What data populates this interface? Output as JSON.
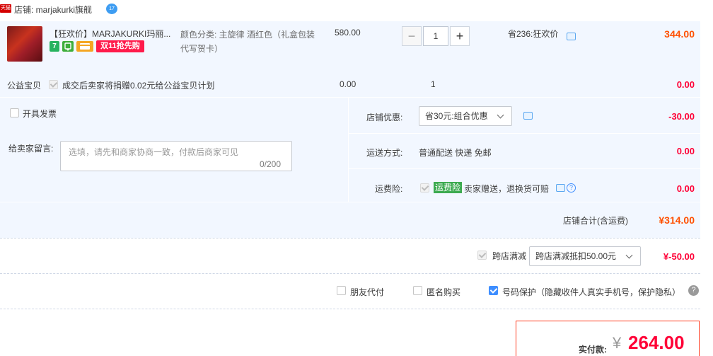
{
  "shop": {
    "badge": "天猫",
    "name": "店铺: marjakurki旗舰",
    "chat_badge": "17"
  },
  "item": {
    "title": "【狂欢价】MARJAKURKI玛丽...",
    "icons": [
      "7-day-return-icon",
      "green-badge-icon",
      "card-icon"
    ],
    "icon7_text": "7",
    "promo_badge": "双11抢先购",
    "sku": "颜色分类: 主旋律 酒红色（礼盒包装 代写贺卡）",
    "unit_price": "580.00",
    "qty_minus": "−",
    "qty": "1",
    "qty_plus": "+",
    "promo": "省236:狂欢价",
    "total": "344.00"
  },
  "charity": {
    "label": "公益宝贝",
    "text": "成交后卖家将捐赠0.02元给公益宝贝计划",
    "price": "0.00",
    "qty": "1",
    "total": "0.00"
  },
  "invoice": {
    "label": "开具发票"
  },
  "message": {
    "label": "给卖家留言:",
    "placeholder": "选填，请先和商家协商一致，付款后商家可见",
    "count": "0/200"
  },
  "shop_discount": {
    "label": "店铺优惠:",
    "selected": "省30元:组合优惠",
    "amount": "-30.00"
  },
  "shipping": {
    "label": "运送方式:",
    "value": "普通配送 快递 免邮",
    "amount": "0.00"
  },
  "freight_insurance": {
    "label": "运费险:",
    "badge": "运费险",
    "text": "卖家赠送，退换货可赔",
    "help": "?",
    "amount": "0.00"
  },
  "shop_total": {
    "label": "店铺合计(含运费)",
    "value": "¥314.00"
  },
  "cross_store": {
    "label": "跨店满减",
    "selected": "跨店满减抵扣50.00元",
    "amount": "¥-50.00"
  },
  "options": {
    "friend_pay": "朋友代付",
    "anonymous": "匿名购买",
    "privacy": "号码保护（隐藏收件人真实手机号，保护隐私）",
    "help": "?"
  },
  "payment": {
    "label": "实付款:",
    "currency": "¥",
    "amount": "264.00"
  },
  "colors": {
    "accent_orange": "#ff5000",
    "accent_red": "#ff0036",
    "panel_bg": "#f2f7ff",
    "checkbox_blue": "#3e8eff"
  }
}
